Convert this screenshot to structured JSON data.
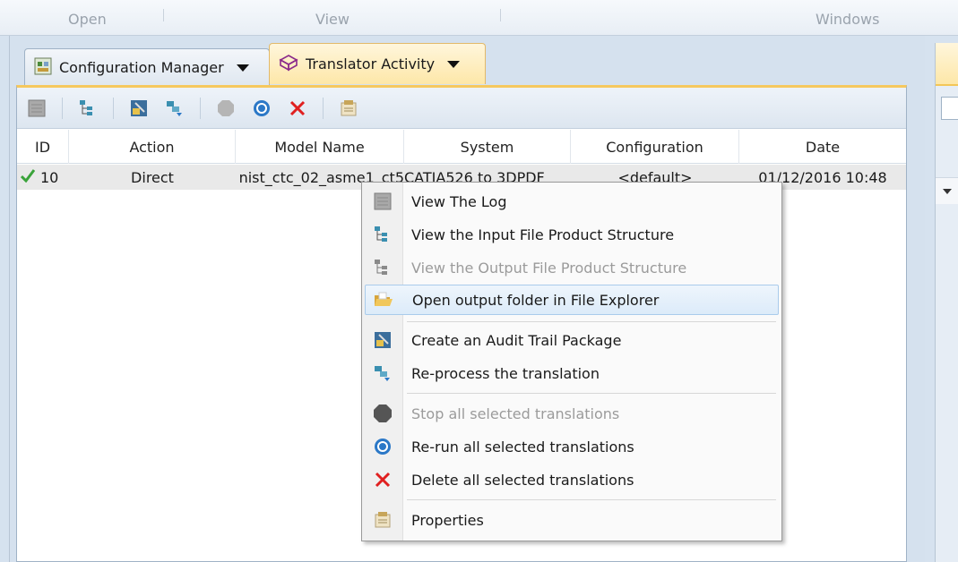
{
  "ribbon": {
    "groups": [
      "Open",
      "View",
      "Windows"
    ]
  },
  "tabs": [
    {
      "label": "Configuration Manager",
      "icon": "config-manager-icon"
    },
    {
      "label": "Translator Activity",
      "icon": "translator-activity-icon"
    }
  ],
  "toolbar": {
    "icons": [
      "view-log-icon",
      "product-structure-icon",
      "audit-package-icon",
      "reprocess-icon",
      "stop-icon",
      "rerun-icon",
      "delete-icon",
      "properties-icon"
    ]
  },
  "grid": {
    "columns": [
      "ID",
      "Action",
      "Model Name",
      "System",
      "Configuration",
      "Date"
    ],
    "rows": [
      {
        "status": "check-icon",
        "id": "10",
        "action": "Direct",
        "model_name": "nist_ctc_02_asme1_ct5",
        "system": "CATIA526 to 3DPDF",
        "configuration": "<default>",
        "date": "01/12/2016 10:48"
      }
    ]
  },
  "context_menu": {
    "items": [
      {
        "label": "View The Log",
        "icon": "log-icon",
        "enabled": true
      },
      {
        "label": "View the Input File Product Structure",
        "icon": "product-structure-icon",
        "enabled": true
      },
      {
        "label": "View the Output File Product Structure",
        "icon": "product-structure-icon",
        "enabled": false
      },
      {
        "label": "Open output folder in File Explorer",
        "icon": "open-folder-icon",
        "enabled": true,
        "highlighted": true
      },
      {
        "label": "Create an Audit Trail Package",
        "icon": "audit-package-icon",
        "enabled": true
      },
      {
        "label": "Re-process the translation",
        "icon": "reprocess-icon",
        "enabled": true
      },
      {
        "label": "Stop all selected translations",
        "icon": "stop-icon",
        "enabled": false
      },
      {
        "label": "Re-run all selected translations",
        "icon": "rerun-icon",
        "enabled": true
      },
      {
        "label": "Delete all selected translations",
        "icon": "delete-icon",
        "enabled": true
      },
      {
        "label": "Properties",
        "icon": "properties-icon",
        "enabled": true
      }
    ]
  },
  "colors": {
    "active_tab": "#fde7a8",
    "highlight": "#dcebf9",
    "check": "#3aa33a",
    "delete": "#e02020",
    "rerun": "#2b78c7"
  }
}
